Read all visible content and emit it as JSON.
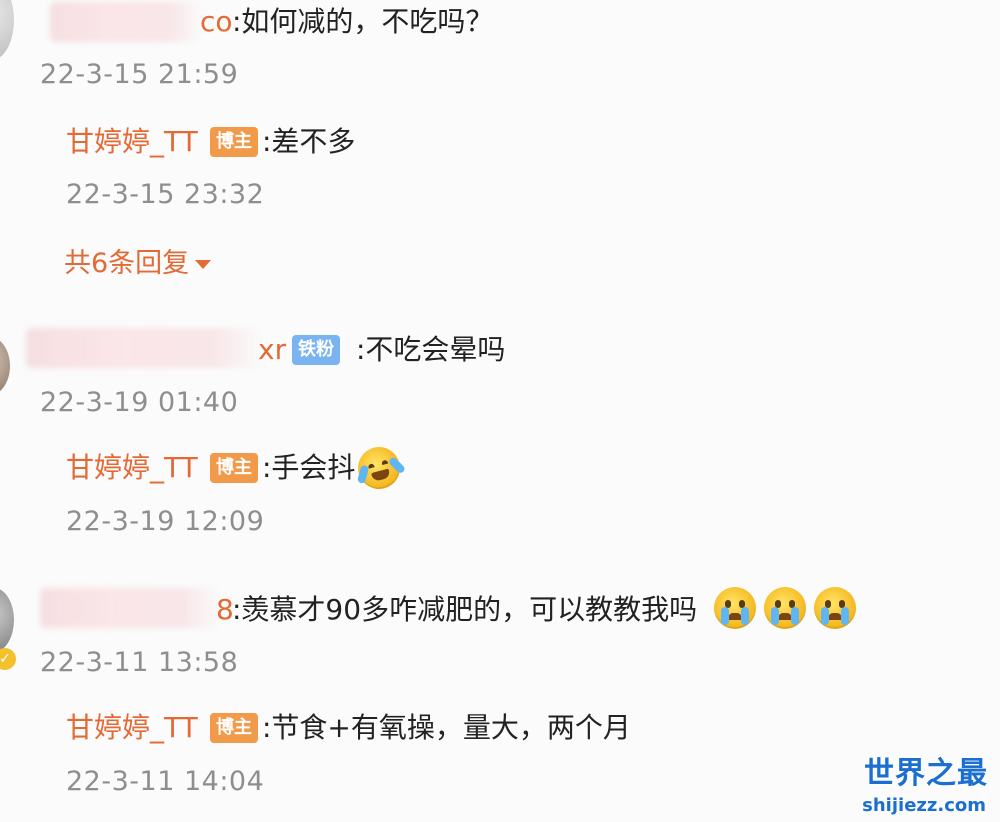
{
  "comments": [
    {
      "author_tail": "co",
      "text": ":如何减的，不吃吗？",
      "time": "22-3-15 21:59",
      "reply": {
        "author": "甘婷婷_TT",
        "badge": "博主",
        "text": ":差不多",
        "time": "22-3-15 23:32",
        "emoji": null
      },
      "more_replies": "共6条回复"
    },
    {
      "author_tail": "xr",
      "badge": "铁粉",
      "text": ":不吃会晕吗",
      "time": "22-3-19 01:40",
      "reply": {
        "author": "甘婷婷_TT",
        "badge": "博主",
        "text": ":手会抖",
        "time": "22-3-19 12:09",
        "emoji": "laugh-cry-emoji"
      }
    },
    {
      "author_tail": "8",
      "text": ":羡慕才90多咋减肥的，可以教教我吗",
      "emojis": [
        "crying-emoji",
        "crying-emoji",
        "crying-emoji"
      ],
      "time": "22-3-11 13:58",
      "reply": {
        "author": "甘婷婷_TT",
        "badge": "博主",
        "text": ":节食+有氧操，量大，两个月",
        "time": "22-3-11 14:04"
      }
    }
  ],
  "watermark": {
    "main": "世界之最",
    "sub": "shijiezz.com"
  },
  "colors": {
    "name": "#e46a35",
    "timestamp": "#8e8e8e",
    "badge_blogger": "#f19a4a",
    "badge_fan": "#79b4f0",
    "watermark": "#1a6fd1"
  }
}
